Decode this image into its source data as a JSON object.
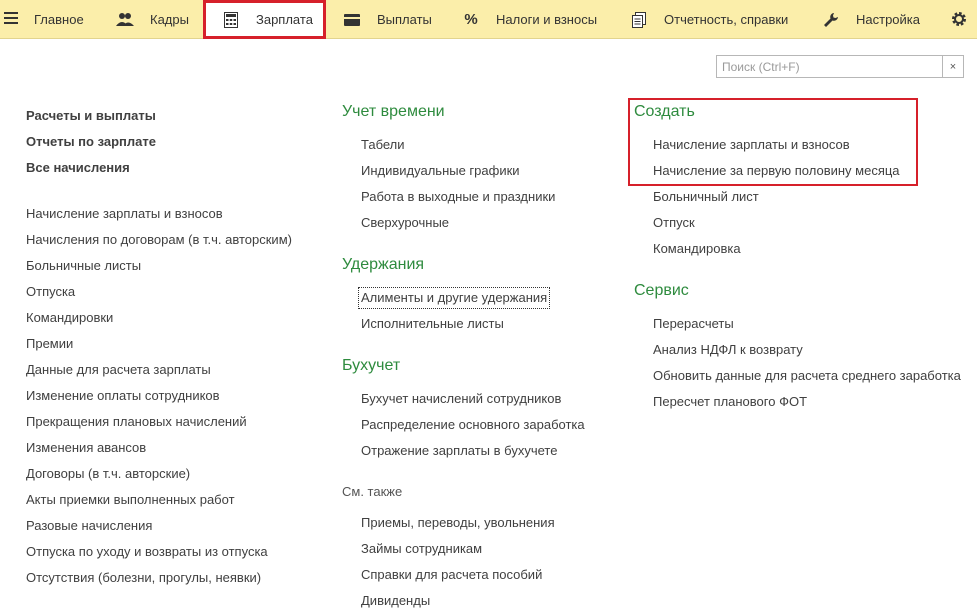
{
  "topbar": {
    "tabs": [
      {
        "label": "Главное",
        "icon": "menu-lines-icon"
      },
      {
        "label": "Кадры",
        "icon": "people-icon"
      },
      {
        "label": "Зарплата",
        "icon": "calculator-icon",
        "active": true
      },
      {
        "label": "Выплаты",
        "icon": "wallet-icon"
      },
      {
        "label": "Налоги и взносы",
        "icon": "percent-icon"
      },
      {
        "label": "Отчетность, справки",
        "icon": "documents-icon"
      },
      {
        "label": "Настройка",
        "icon": "wrench-icon"
      }
    ],
    "percent_glyph": "%"
  },
  "search": {
    "placeholder": "Поиск (Ctrl+F)",
    "value": "",
    "clear": "×"
  },
  "left": {
    "bold_links": [
      "Расчеты и выплаты",
      "Отчеты по зарплате",
      "Все начисления"
    ],
    "links": [
      "Начисление зарплаты и взносов",
      "Начисления по договорам (в т.ч. авторским)",
      "Больничные листы",
      "Отпуска",
      "Командировки",
      "Премии",
      "Данные для расчета зарплаты",
      "Изменение оплаты сотрудников",
      "Прекращения плановых начислений",
      "Изменения авансов",
      "Договоры (в т.ч. авторские)",
      "Акты приемки выполненных работ",
      "Разовые начисления",
      "Отпуска по уходу и возвраты из отпуска",
      "Отсутствия (болезни, прогулы, неявки)"
    ]
  },
  "middle": {
    "time": {
      "heading": "Учет времени",
      "links": [
        "Табели",
        "Индивидуальные графики",
        "Работа в выходные и праздники",
        "Сверхурочные"
      ]
    },
    "deductions": {
      "heading": "Удержания",
      "links": [
        "Алименты и другие удержания",
        "Исполнительные листы"
      ]
    },
    "accounting": {
      "heading": "Бухучет",
      "links": [
        "Бухучет начислений сотрудников",
        "Распределение основного заработка",
        "Отражение зарплаты в бухучете"
      ]
    },
    "see_also": {
      "heading": "См. также",
      "links": [
        "Приемы, переводы, увольнения",
        "Займы сотрудникам",
        "Справки для расчета пособий",
        "Дивиденды"
      ]
    }
  },
  "right": {
    "create": {
      "heading": "Создать",
      "links": [
        "Начисление зарплаты и взносов",
        "Начисление за первую половину месяца",
        "Больничный лист",
        "Отпуск",
        "Командировка"
      ]
    },
    "service": {
      "heading": "Сервис",
      "links": [
        "Перерасчеты",
        "Анализ НДФЛ к возврату",
        "Обновить данные для расчета среднего заработка",
        "Пересчет планового ФОТ"
      ]
    }
  },
  "colors": {
    "accent_green": "#2e8b3e",
    "topbar_bg": "#fbeeaa",
    "highlight_red": "#d6202a"
  }
}
